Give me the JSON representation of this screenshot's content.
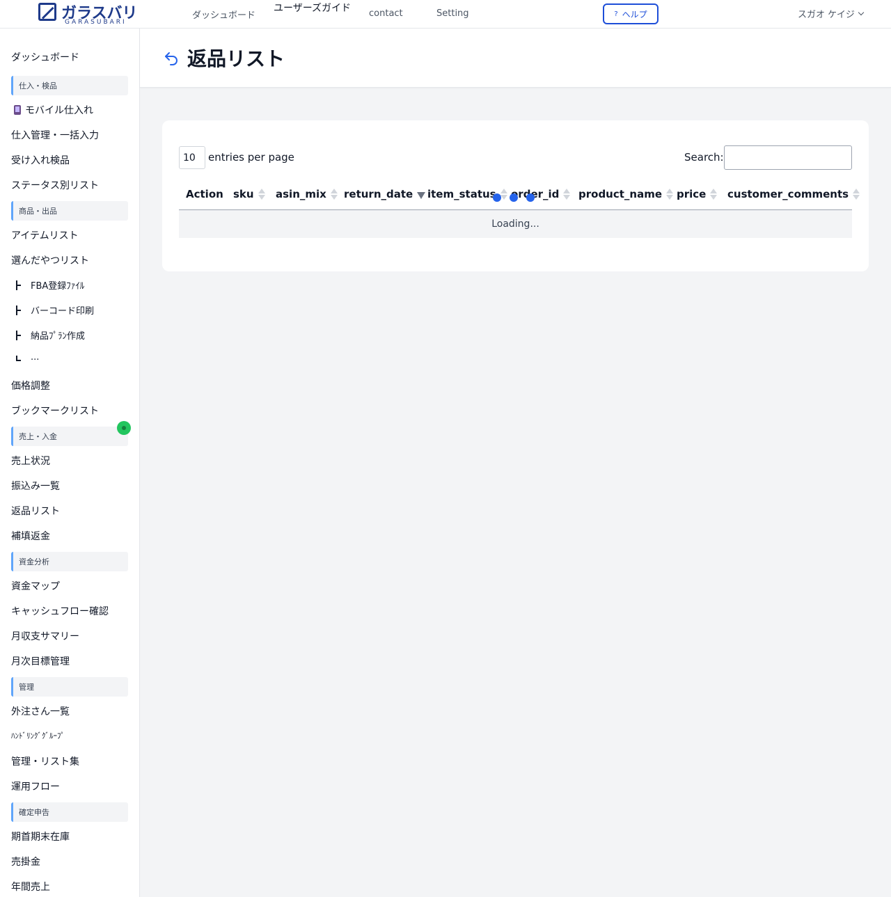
{
  "topnav": {
    "logo_main": "ガラスバリ",
    "logo_sub": "GARASUBARI",
    "links": [
      "ダッシュボード",
      "ユーザーズガイド",
      "contact",
      "Setting"
    ],
    "help_label": "ヘルプ",
    "help_icon": "?",
    "user_name": "スガオ ケイジ"
  },
  "sidebar": {
    "dashboard": "ダッシュボード",
    "sections": [
      "仕入・検品",
      "商品・出品",
      "売上・入金",
      "資金分析",
      "管理",
      "確定申告"
    ],
    "items": {
      "mobile_purchase": "モバイル仕入れ",
      "purchase_mgmt": "仕入管理・一括入力",
      "receive_inspect": "受け入れ検品",
      "status_list": "ステータス別リスト",
      "item_list": "アイテムリスト",
      "selected_list": "選んだやつリスト",
      "fba_file": "FBA登録ﾌｧｲﾙ",
      "barcode_print": "バーコード印刷",
      "delivery_plan": "納品ﾌﾟﾗﾝ作成",
      "more": "...",
      "price_adjust": "価格調整",
      "bookmark_list": "ブックマークリスト",
      "sales_status": "売上状況",
      "transfer_list": "振込み一覧",
      "return_list": "返品リスト",
      "refund": "補填返金",
      "fund_map": "資金マップ",
      "cashflow": "キャッシュフロー確認",
      "monthly_summary": "月収支サマリー",
      "monthly_goal": "月次目標管理",
      "outsource_list": "外注さん一覧",
      "handling_group": "ﾊﾝﾄﾞﾘﾝｸﾞｸﾞﾙｰﾌﾟ",
      "mgmt_lists": "管理・リスト集",
      "operation_flow": "運用フロー",
      "period_inventory": "期首期末在庫",
      "receivables": "売掛金",
      "annual_sales": "年間売上"
    }
  },
  "page": {
    "title": "返品リスト"
  },
  "table": {
    "per_page_value": "10",
    "per_page_label": "entries per page",
    "search_label": "Search:",
    "columns": [
      "Action",
      "sku",
      "asin_mix",
      "return_date",
      "item_status",
      "order_id",
      "product_name",
      "price",
      "customer_comments"
    ],
    "sorted_column": "return_date",
    "sort_direction": "desc",
    "loading_text": "Loading..."
  },
  "colors": {
    "brand": "#1e3a8a",
    "accent": "#2563eb",
    "section_bar": "#60a5fa",
    "badge": "#22c55e"
  }
}
